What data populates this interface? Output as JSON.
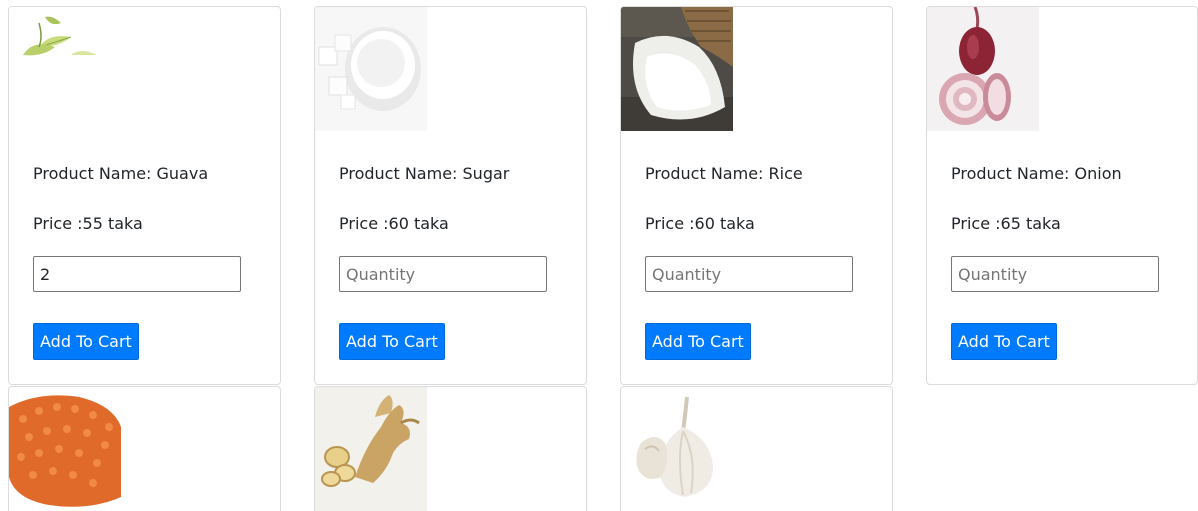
{
  "products": [
    {
      "name_label": "Product Name: Guava",
      "price_label": "Price :55 taka",
      "quantity_value": "2",
      "quantity_placeholder": "Quantity",
      "button_label": "Add To Cart",
      "image_icon": "guava-leaf-icon"
    },
    {
      "name_label": "Product Name: Sugar",
      "price_label": "Price :60 taka",
      "quantity_value": "",
      "quantity_placeholder": "Quantity",
      "button_label": "Add To Cart",
      "image_icon": "sugar-bowl-icon"
    },
    {
      "name_label": "Product Name: Rice",
      "price_label": "Price :60 taka",
      "quantity_value": "",
      "quantity_placeholder": "Quantity",
      "button_label": "Add To Cart",
      "image_icon": "rice-sack-icon"
    },
    {
      "name_label": "Product Name: Onion",
      "price_label": "Price :65 taka",
      "quantity_value": "",
      "quantity_placeholder": "Quantity",
      "button_label": "Add To Cart",
      "image_icon": "onion-icon"
    },
    {
      "image_icon": "lentils-icon"
    },
    {
      "image_icon": "ginger-icon"
    },
    {
      "image_icon": "garlic-icon"
    }
  ],
  "colors": {
    "button_bg": "#007bff",
    "button_text": "#ffffff",
    "card_border": "#dcdcdc"
  }
}
